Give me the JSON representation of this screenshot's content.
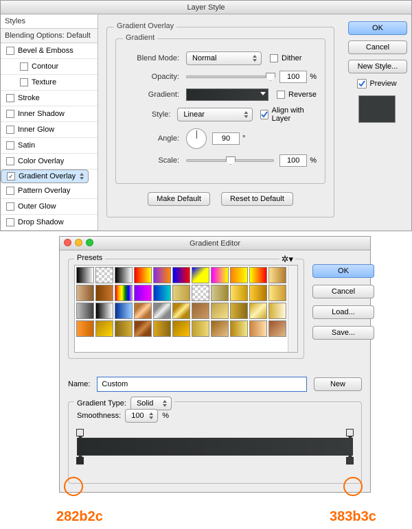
{
  "layer_style": {
    "title": "Layer Style",
    "left_header": "Styles",
    "left_sub": "Blending Options: Default",
    "items": [
      {
        "label": "Bevel & Emboss",
        "checked": false,
        "indent": 0
      },
      {
        "label": "Contour",
        "checked": false,
        "indent": 1
      },
      {
        "label": "Texture",
        "checked": false,
        "indent": 1
      },
      {
        "label": "Stroke",
        "checked": false,
        "indent": 0
      },
      {
        "label": "Inner Shadow",
        "checked": false,
        "indent": 0
      },
      {
        "label": "Inner Glow",
        "checked": false,
        "indent": 0
      },
      {
        "label": "Satin",
        "checked": false,
        "indent": 0
      },
      {
        "label": "Color Overlay",
        "checked": false,
        "indent": 0
      },
      {
        "label": "Gradient Overlay",
        "checked": true,
        "indent": 0,
        "selected": true
      },
      {
        "label": "Pattern Overlay",
        "checked": false,
        "indent": 0
      },
      {
        "label": "Outer Glow",
        "checked": false,
        "indent": 0
      },
      {
        "label": "Drop Shadow",
        "checked": false,
        "indent": 0
      }
    ],
    "section_title": "Gradient Overlay",
    "subsection_title": "Gradient",
    "blend_mode_label": "Blend Mode:",
    "blend_mode_value": "Normal",
    "dither_label": "Dither",
    "dither_checked": false,
    "opacity_label": "Opacity:",
    "opacity_value": "100",
    "opacity_suffix": "%",
    "gradient_label": "Gradient:",
    "reverse_label": "Reverse",
    "reverse_checked": false,
    "style_label": "Style:",
    "style_value": "Linear",
    "align_label": "Align with Layer",
    "align_checked": true,
    "angle_label": "Angle:",
    "angle_value": "90",
    "angle_suffix": "°",
    "scale_label": "Scale:",
    "scale_value": "100",
    "scale_suffix": "%",
    "btn_make_default": "Make Default",
    "btn_reset_default": "Reset to Default",
    "btn_ok": "OK",
    "btn_cancel": "Cancel",
    "btn_new_style": "New Style...",
    "preview_label": "Preview",
    "preview_checked": true
  },
  "gradient_editor": {
    "title": "Gradient Editor",
    "presets_label": "Presets",
    "btn_ok": "OK",
    "btn_cancel": "Cancel",
    "btn_load": "Load...",
    "btn_save": "Save...",
    "name_label": "Name:",
    "name_value": "Custom",
    "btn_new": "New",
    "gradient_type_label": "Gradient Type:",
    "gradient_type_value": "Solid",
    "smoothness_label": "Smoothness:",
    "smoothness_value": "100",
    "smoothness_suffix": "%",
    "stop_left_hex": "282b2c",
    "stop_right_hex": "383b3c",
    "presets": [
      "linear-gradient(90deg,#000,#fff)",
      "repeating-conic-gradient(#ccc 0 25%,#fff 0 50%) 0/8px 8px",
      "linear-gradient(90deg,#000,#fff)",
      "linear-gradient(90deg,#f00,#ff0)",
      "linear-gradient(90deg,#8a2be2,#ff8c00)",
      "linear-gradient(90deg,#0000ff,#ff0000)",
      "linear-gradient(135deg,#00f,#ff0,#ff0)",
      "linear-gradient(90deg,#f0f,#ff0)",
      "linear-gradient(90deg,#ff7f00,#ffff00)",
      "linear-gradient(90deg,#ff0,#f00)",
      "linear-gradient(90deg,#ffdf8c,#b07c2e)",
      "linear-gradient(90deg,#d9b38c,#8b5a2b)",
      "linear-gradient(90deg,#804000,#c87830)",
      "linear-gradient(90deg,red,orange,yellow,green,blue,violet)",
      "linear-gradient(90deg,#8000ff,#ff00ff)",
      "linear-gradient(90deg,#0033cc,#00cccc)",
      "linear-gradient(90deg,#e0d080,#c0a040)",
      "repeating-conic-gradient(#ccc 0 25%,#fff 0 50%) 0/8px 8px",
      "linear-gradient(90deg,#d0c890,#a08830)",
      "linear-gradient(90deg,#ffe066,#cc9900)",
      "linear-gradient(90deg,#ffcc33,#b37700)",
      "linear-gradient(90deg,#ffe680,#cc9933)",
      "linear-gradient(90deg,#c0c0c0,#404040)",
      "linear-gradient(90deg,#000,#fff)",
      "linear-gradient(90deg,#003399,#99ccff)",
      "linear-gradient(135deg,#b87333 25%,#ffcc99 50%,#b87333 75%)",
      "linear-gradient(135deg,#888 25%,#eee 50%,#888 75%)",
      "linear-gradient(135deg,#b8860b 25%,#ffec8b 50%,#b8860b 75%)",
      "linear-gradient(135deg,#996633,#cc9966)",
      "linear-gradient(135deg,#bfa14a,#f5e08b)",
      "linear-gradient(90deg,#d4af37,#8b6914)",
      "linear-gradient(135deg,#c9a227,#fff3b0,#c9a227)",
      "linear-gradient(90deg,#d4af37,#fff8dc)",
      "linear-gradient(90deg,#ff9933,#cc6600)",
      "linear-gradient(135deg,#b8860b,#ffd700)",
      "linear-gradient(90deg,#8b6914,#d4af37)",
      "linear-gradient(135deg,#8b4513 25%,#cd853f 50%,#8b4513 75%)",
      "linear-gradient(90deg,#daa520,#8b6914)",
      "linear-gradient(135deg,#a67c00,#ffbf00)",
      "linear-gradient(90deg,#c0a030,#f0d878)",
      "linear-gradient(135deg,#996515,#e6be8a)",
      "linear-gradient(90deg,#b8860b,#f0e68c)",
      "linear-gradient(90deg,#cd853f,#ffdead)",
      "linear-gradient(135deg,#a0522d,#deb887)"
    ]
  }
}
